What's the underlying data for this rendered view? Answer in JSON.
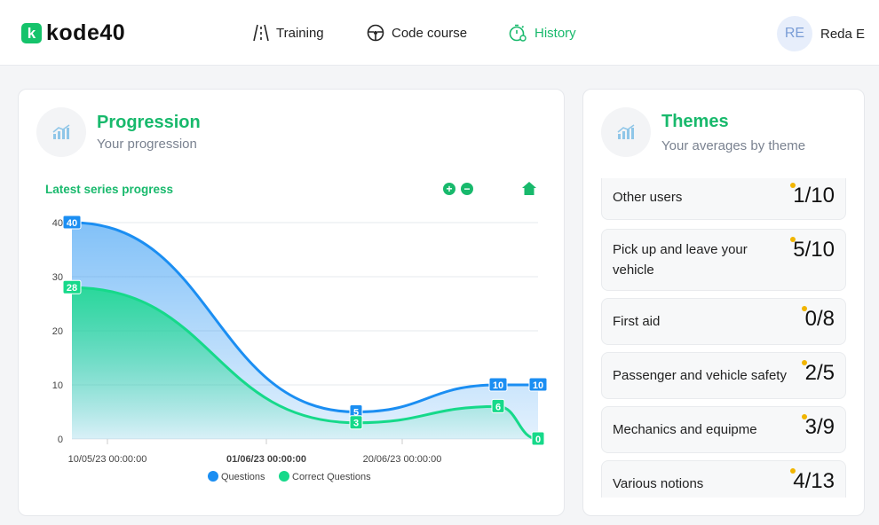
{
  "brand": {
    "mark": "k",
    "name": "kode40"
  },
  "nav": [
    {
      "label": "Training",
      "icon": "road-icon"
    },
    {
      "label": "Code course",
      "icon": "steering-wheel-icon"
    },
    {
      "label": "History",
      "icon": "stopwatch-icon",
      "active": true
    }
  ],
  "user": {
    "initials": "RE",
    "name": "Reda E"
  },
  "progression": {
    "title": "Progression",
    "subtitle": "Your progression",
    "chart_title": "Latest series progress",
    "zoom_in": "+",
    "zoom_out": "−"
  },
  "themes": {
    "title": "Themes",
    "subtitle": "Your averages by theme",
    "items": [
      {
        "label": "Other users",
        "score": "1/10"
      },
      {
        "label": "Pick up and leave your vehicle",
        "score": "5/10"
      },
      {
        "label": "First aid",
        "score": "0/8"
      },
      {
        "label": "Passenger and vehicle safety",
        "score": "2/5"
      },
      {
        "label": "Mechanics and equipme",
        "score": "3/9"
      },
      {
        "label": "Various notions",
        "score": "4/13"
      }
    ]
  },
  "colors": {
    "accent": "#18b96c",
    "questions": "#1b8ef2",
    "correct": "#16d98a"
  },
  "chart_data": {
    "type": "area",
    "title": "Latest series progress",
    "x_ticks": [
      "10/05/23 00:00:00",
      "01/06/23 00:00:00",
      "20/06/23 00:00:00"
    ],
    "y_ticks": [
      0,
      10,
      20,
      30,
      40
    ],
    "ylim": [
      0,
      40
    ],
    "series": [
      {
        "name": "Questions",
        "values": [
          40,
          5,
          10,
          10
        ]
      },
      {
        "name": "Correct Questions",
        "values": [
          28,
          3,
          6,
          0
        ]
      }
    ],
    "legend": "bottom-center",
    "grid": true
  }
}
